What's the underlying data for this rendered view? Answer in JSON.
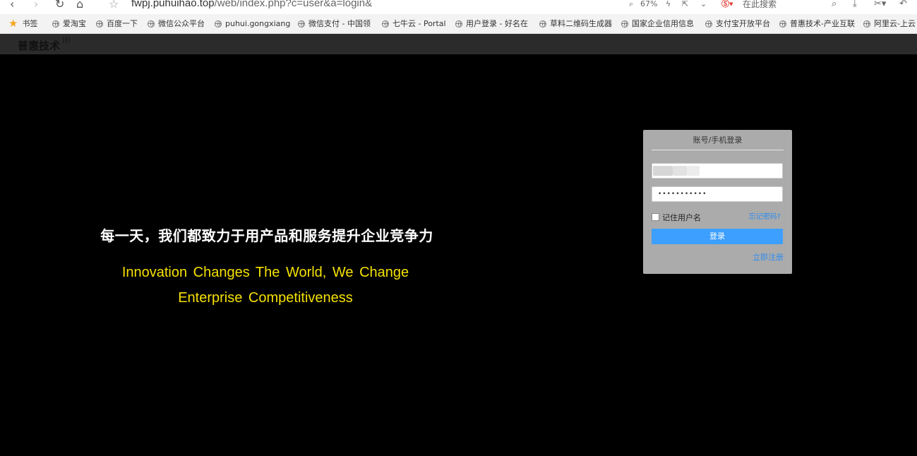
{
  "browser": {
    "url_host": "fwpj.puhuihao.top",
    "url_path": "/web/index.php?c=user&a=login&",
    "zoom": "67%",
    "search_placeholder": "在此搜索",
    "bookmarks_label": "书签",
    "bookmarks": [
      "爱淘宝",
      "百度一下",
      "微信公众平台",
      "puhui.gongxiang",
      "微信支付 - 中国领",
      "七牛云 - Portal",
      "用户登录 - 好名在",
      "草料二维码生成器",
      "国家企业信用信息",
      "支付宝开放平台",
      "普惠技术-产业互联",
      "阿里云-上云"
    ]
  },
  "site": {
    "logo": "普惠技术"
  },
  "hero": {
    "slogan_cn": "每一天，我们都致力于用产品和服务提升企业竞争力",
    "slogan_en_line1": "Innovation Changes The World, We Change",
    "slogan_en_line2": "Enterprise Competitiveness"
  },
  "login": {
    "title": "账号/手机登录",
    "username_value": "",
    "password_value": "•••••••••••",
    "remember_label": "记住用户名",
    "forgot_label": "忘记密码?",
    "submit_label": "登录",
    "register_label": "立即注册"
  },
  "colors": {
    "background": "#000000",
    "header": "#2b2b2b",
    "slogan_en": "#f5e100",
    "card": "#ababab",
    "accent": "#3d9fff",
    "link": "#2d8cf0"
  }
}
